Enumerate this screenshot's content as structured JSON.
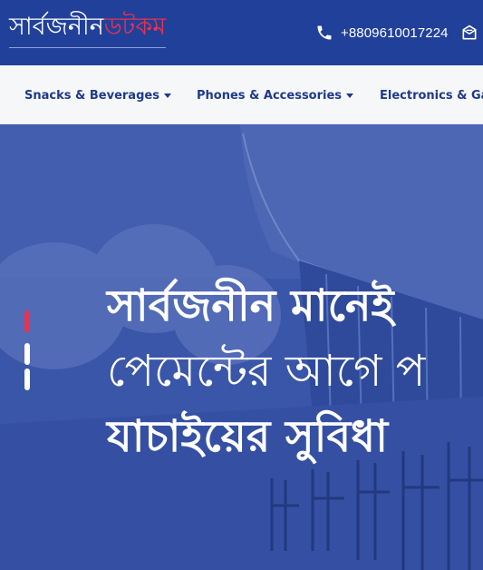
{
  "header": {
    "logo_white": "সার্বজনীন",
    "logo_red": "ডটকম",
    "phone": "+8809610017224",
    "icons": {
      "phone": "phone-icon",
      "mail": "mail-icon"
    },
    "colors": {
      "header_bg": "#21409a",
      "logo_accent": "#e8334f"
    }
  },
  "nav": {
    "items": [
      {
        "label": "Snacks & Beverages"
      },
      {
        "label": "Phones & Accessories"
      },
      {
        "label": "Electronics & Ga"
      }
    ],
    "icons": {
      "dropdown": "caret-down-icon"
    },
    "colors": {
      "nav_text": "#1e3a8a",
      "nav_bg": "#f6f7f9"
    }
  },
  "hero": {
    "line1": "সার্বজনীন মানেই",
    "line2": "পেমেন্টের আগে প",
    "line3": "যাচাইয়ের সুবিধা",
    "slides": {
      "count": 3,
      "active": 1
    },
    "colors": {
      "overlay": "#3a56a9",
      "active_indicator": "#e8334f"
    }
  }
}
